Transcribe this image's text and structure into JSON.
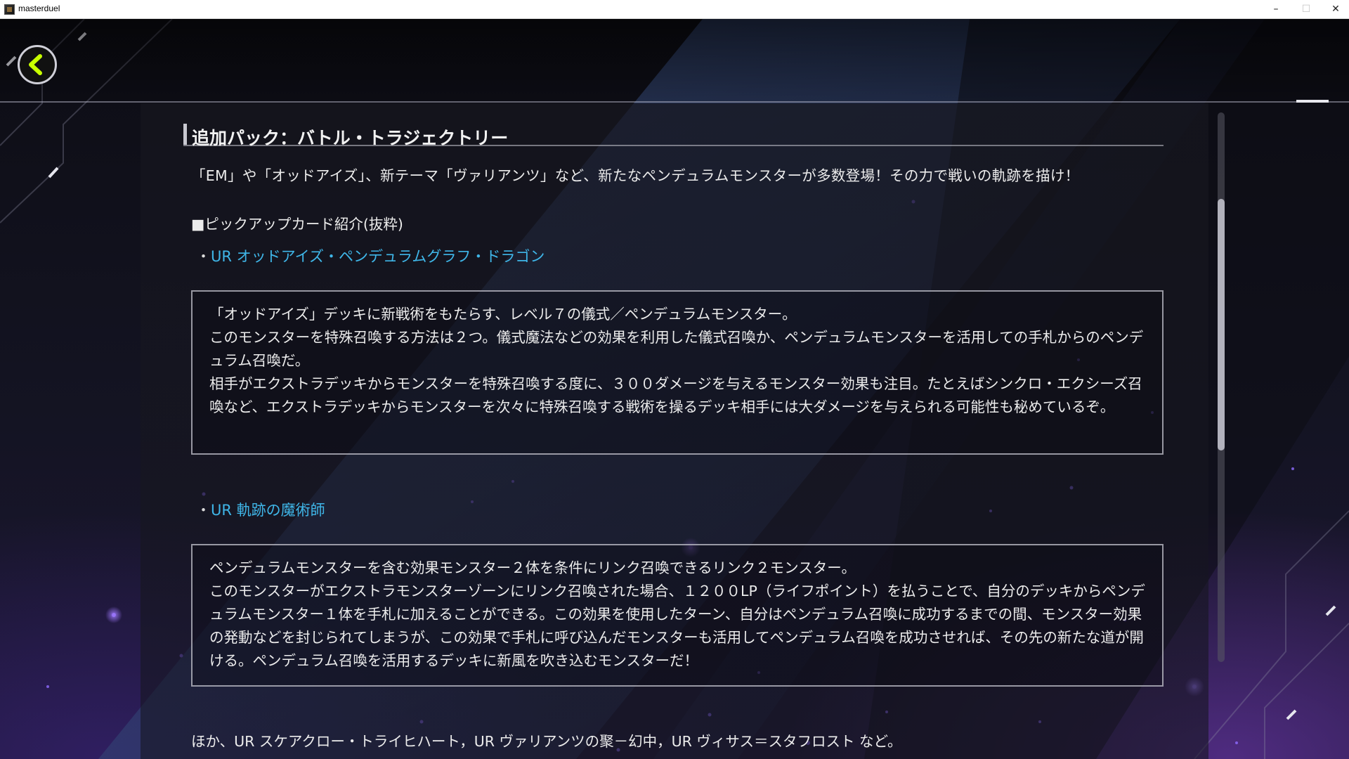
{
  "window": {
    "title": "masterduel",
    "minimize": "–",
    "maximize": "☐",
    "close": "✕"
  },
  "colors": {
    "link": "#3fb6e8",
    "back_arrow": "#c8ff00",
    "text": "#ececec"
  },
  "icons": {
    "back": "chevron-left-icon",
    "app": "masterduel-app-icon"
  },
  "article": {
    "heading": "追加パック：バトル・トラジェクトリー",
    "description": "「EM」や「オッドアイズ」、新テーマ「ヴァリアンツ」など、新たなペンデュラムモンスターが多数登場！その力で戦いの軌跡を描け！",
    "section_label": "■ピックアップカード紹介(抜粋)",
    "cards": [
      {
        "bullet": "・",
        "name": "UR オッドアイズ・ペンデュラムグラフ・ドラゴン",
        "paragraphs": [
          "「オッドアイズ」デッキに新戦術をもたらす、レベル７の儀式／ペンデュラムモンスター。",
          "このモンスターを特殊召喚する方法は２つ。儀式魔法などの効果を利用した儀式召喚か、ペンデュラムモンスターを活用しての手札からのペンデュラム召喚だ。",
          "相手がエクストラデッキからモンスターを特殊召喚する度に、３００ダメージを与えるモンスター効果も注目。たとえばシンクロ・エクシーズ召喚など、エクストラデッキからモンスターを次々に特殊召喚する戦術を操るデッキ相手には大ダメージを与えられる可能性も秘めているぞ。"
        ]
      },
      {
        "bullet": "・",
        "name": "UR 軌跡の魔術師",
        "paragraphs": [
          "ペンデュラムモンスターを含む効果モンスター２体を条件にリンク召喚できるリンク２モンスター。",
          "このモンスターがエクストラモンスターゾーンにリンク召喚された場合、１２００LP（ライフポイント）を払うことで、自分のデッキからペンデュラムモンスター１体を手札に加えることができる。この効果を使用したターン、自分はペンデュラム召喚に成功するまでの間、モンスター効果の発動などを封じられてしまうが、この効果で手札に呼び込んだモンスターも活用してペンデュラム召喚を成功させれば、その先の新たな道が開ける。ペンデュラム召喚を活用するデッキに新風を吹き込むモンスターだ！"
        ]
      }
    ],
    "footer": "ほか、UR スケアクロー・トライヒハート，UR ヴァリアンツの聚－幻中，UR ヴィサス＝スタフロスト など。"
  },
  "scroll": {
    "position": 0.29
  }
}
